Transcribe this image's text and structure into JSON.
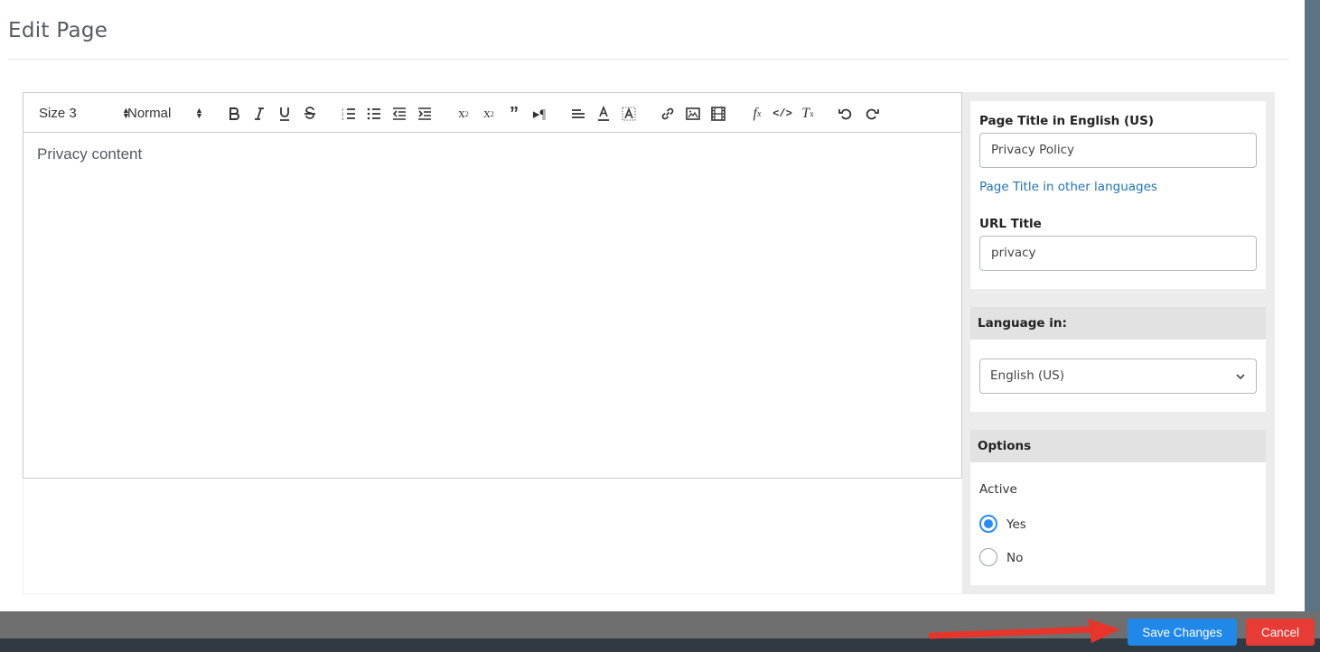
{
  "modal": {
    "title": "Edit Page"
  },
  "toolbar": {
    "size_select": "Size 3",
    "format_select": "Normal",
    "icons": [
      "bold-icon",
      "italic-icon",
      "underline-icon",
      "strike-icon",
      "ordered-list-icon",
      "bullet-list-icon",
      "outdent-icon",
      "indent-icon",
      "superscript-icon",
      "subscript-icon",
      "blockquote-icon",
      "text-direction-icon",
      "align-icon",
      "text-color-icon",
      "background-color-icon",
      "link-icon",
      "image-icon",
      "video-icon",
      "formula-icon",
      "code-icon",
      "clear-format-icon",
      "undo-icon",
      "redo-icon"
    ]
  },
  "editor": {
    "content": "Privacy content"
  },
  "side": {
    "page_title_label": "Page Title in English (US)",
    "page_title_value": "Privacy Policy",
    "other_languages_link": "Page Title in other languages",
    "url_title_label": "URL Title",
    "url_title_value": "privacy",
    "language_header": "Language in:",
    "language_selected": "English (US)",
    "options_header": "Options",
    "active_label": "Active",
    "radio_yes": "Yes",
    "radio_no": "No",
    "active_value": "Yes"
  },
  "footer": {
    "save_label": "Save Changes",
    "cancel_label": "Cancel"
  },
  "colors": {
    "save": "#1f88e8",
    "cancel": "#e73b35",
    "link": "#1f75b8",
    "annotation_arrow": "#e8352b"
  }
}
